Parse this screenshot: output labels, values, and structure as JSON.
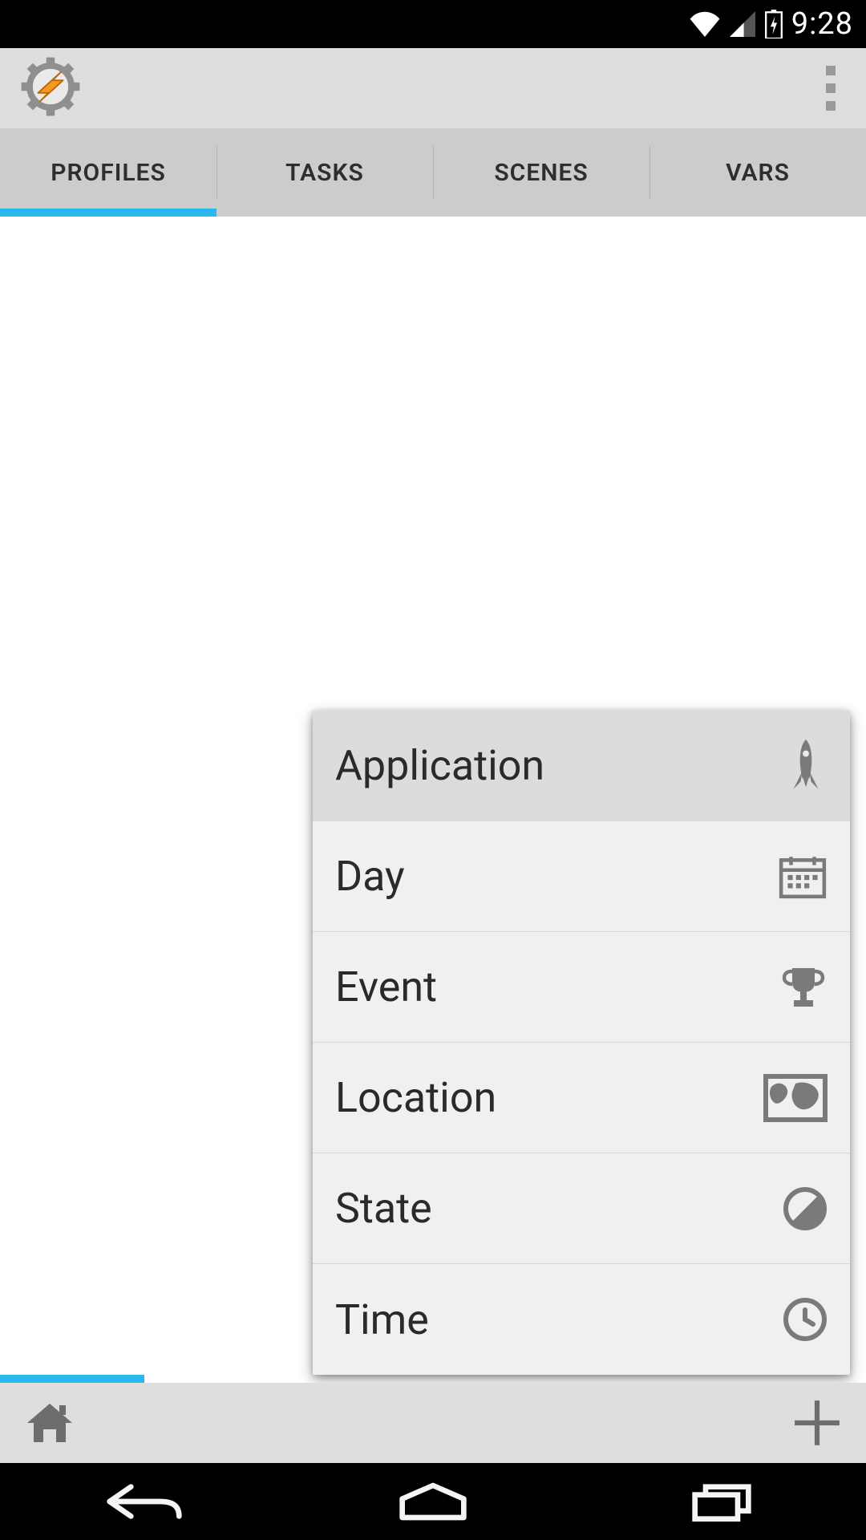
{
  "statusbar": {
    "time": "9:28"
  },
  "tabs": {
    "items": [
      {
        "label": "PROFILES"
      },
      {
        "label": "TASKS"
      },
      {
        "label": "SCENES"
      },
      {
        "label": "VARS"
      }
    ],
    "active_index": 0
  },
  "popup": {
    "items": [
      {
        "label": "Application"
      },
      {
        "label": "Day"
      },
      {
        "label": "Event"
      },
      {
        "label": "Location"
      },
      {
        "label": "State"
      },
      {
        "label": "Time"
      }
    ],
    "selected_index": 0
  }
}
